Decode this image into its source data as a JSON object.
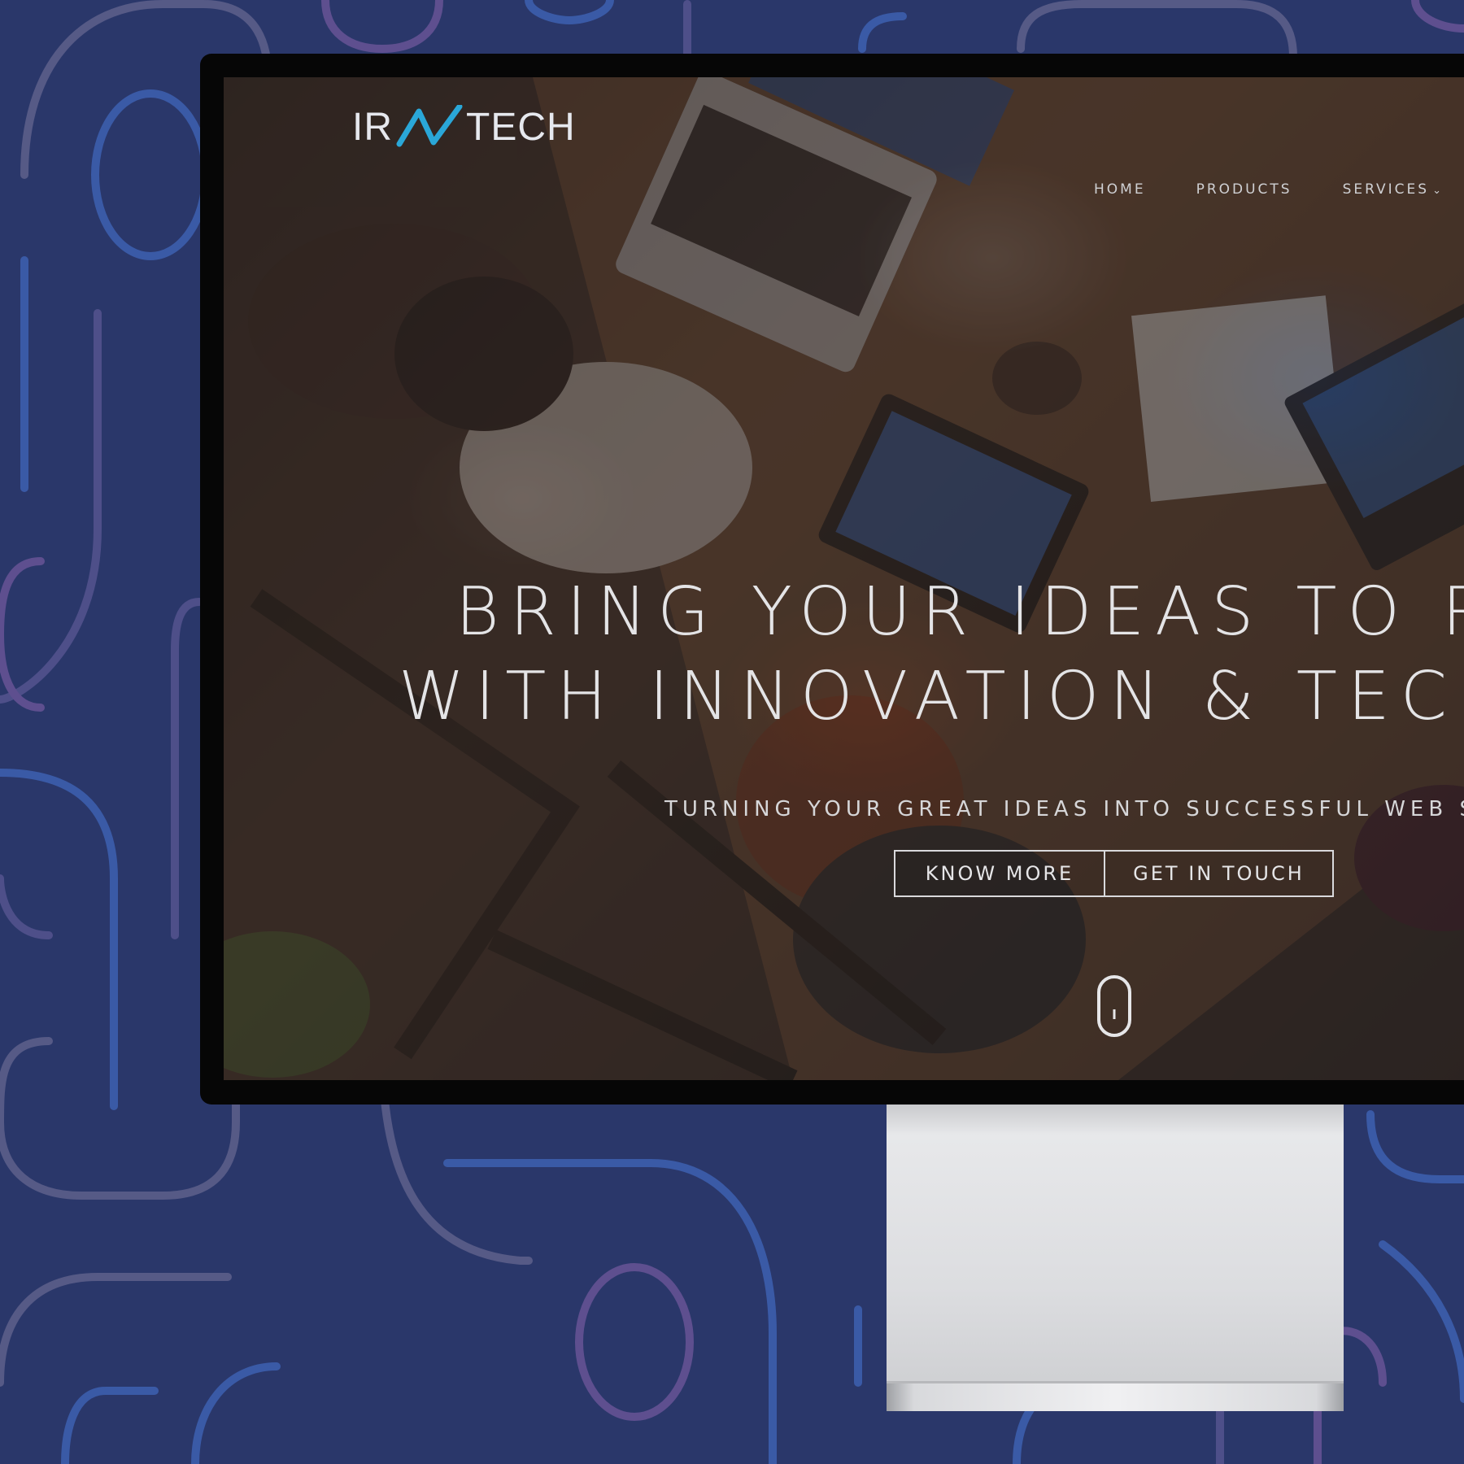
{
  "site": {
    "logo": {
      "text_left": "IR",
      "text_right": "TECH",
      "accent_color": "#2aa7d8"
    },
    "nav": {
      "items": [
        {
          "label": "HOME"
        },
        {
          "label": "PRODUCTS"
        },
        {
          "label": "SERVICES",
          "has_dropdown": true,
          "icon": "chevron-down-icon"
        }
      ]
    },
    "hero": {
      "line1": "BRING YOUR IDEAS TO R",
      "line2": "WITH INNOVATION & TECH",
      "subtitle": "TURNING YOUR GREAT IDEAS INTO SUCCESSFUL WEB SOLU",
      "buttons": [
        {
          "label": "KNOW MORE"
        },
        {
          "label": "GET IN TOUCH"
        }
      ],
      "scroll_icon": "mouse-scroll-icon"
    }
  },
  "colors": {
    "background": "#2a376a",
    "bezel": "#060606",
    "stand": "#dcdde0"
  }
}
